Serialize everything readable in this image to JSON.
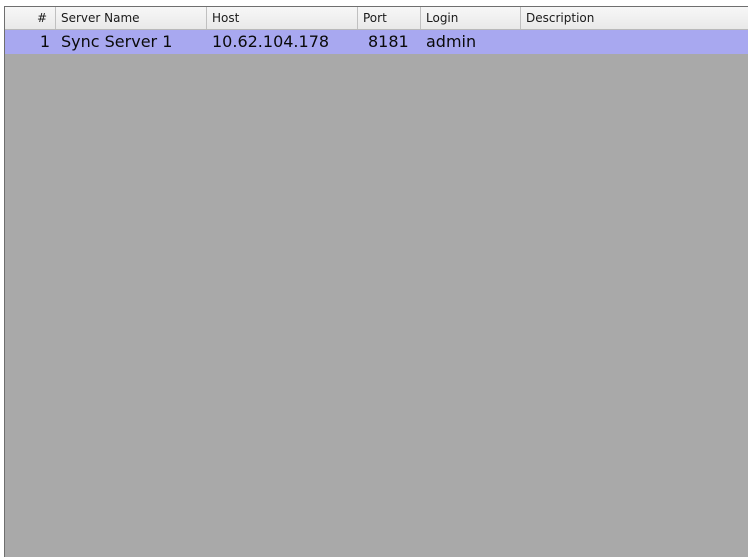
{
  "table": {
    "columns": {
      "index": "#",
      "server_name": "Server Name",
      "host": "Host",
      "port": "Port",
      "login": "Login",
      "description": "Description"
    },
    "rows": [
      {
        "index": "1",
        "server_name": "Sync Server 1",
        "host": "10.62.104.178",
        "port": "8181",
        "login": "admin",
        "description": ""
      }
    ],
    "selected_row_color": "#a8a8f0",
    "background_color": "#a9a9a9"
  }
}
